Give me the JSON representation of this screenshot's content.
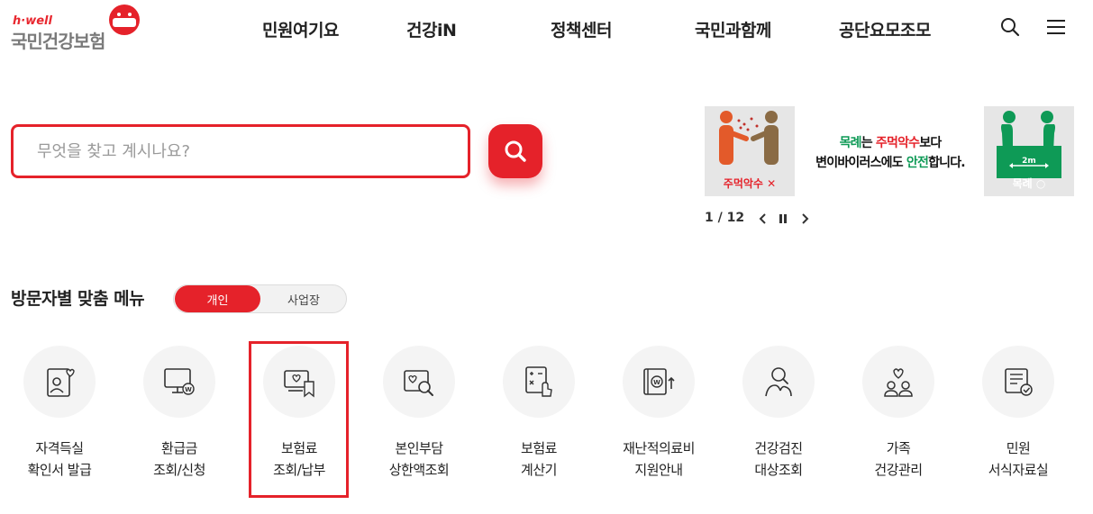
{
  "header": {
    "logo_small": "h·well",
    "logo_main": "국민건강보험",
    "nav": [
      "민원여기요",
      "건강iN",
      "정책센터",
      "국민과함께",
      "공단요모조모"
    ]
  },
  "search": {
    "placeholder": "무엇을 찾고 계시나요?"
  },
  "banner": {
    "left_caption": "주먹악수 ✕",
    "right_caption": "목례 ○",
    "right_distance": "2m",
    "line1_a": "목례",
    "line1_b": "는 ",
    "line1_c": "주먹악수",
    "line1_d": "보다",
    "line2_a": "변이바이러스에도 ",
    "line2_b": "안전",
    "line2_c": "합니다.",
    "pager": "1 / 12"
  },
  "audience": {
    "title": "방문자별 맞춤 메뉴",
    "toggle_active": "개인",
    "toggle_inactive": "사업장"
  },
  "services": [
    {
      "line1": "자격득실",
      "line2": "확인서 발급"
    },
    {
      "line1": "환급금",
      "line2": "조회/신청"
    },
    {
      "line1": "보험료",
      "line2": "조회/납부"
    },
    {
      "line1": "본인부담",
      "line2": "상한액조회"
    },
    {
      "line1": "보험료",
      "line2": "계산기"
    },
    {
      "line1": "재난적의료비",
      "line2": "지원안내"
    },
    {
      "line1": "건강검진",
      "line2": "대상조회"
    },
    {
      "line1": "가족",
      "line2": "건강관리"
    },
    {
      "line1": "민원",
      "line2": "서식자료실"
    }
  ],
  "colors": {
    "accent": "#e5222a",
    "green": "#0e9a56",
    "icon_bg": "#f4f4f4"
  }
}
